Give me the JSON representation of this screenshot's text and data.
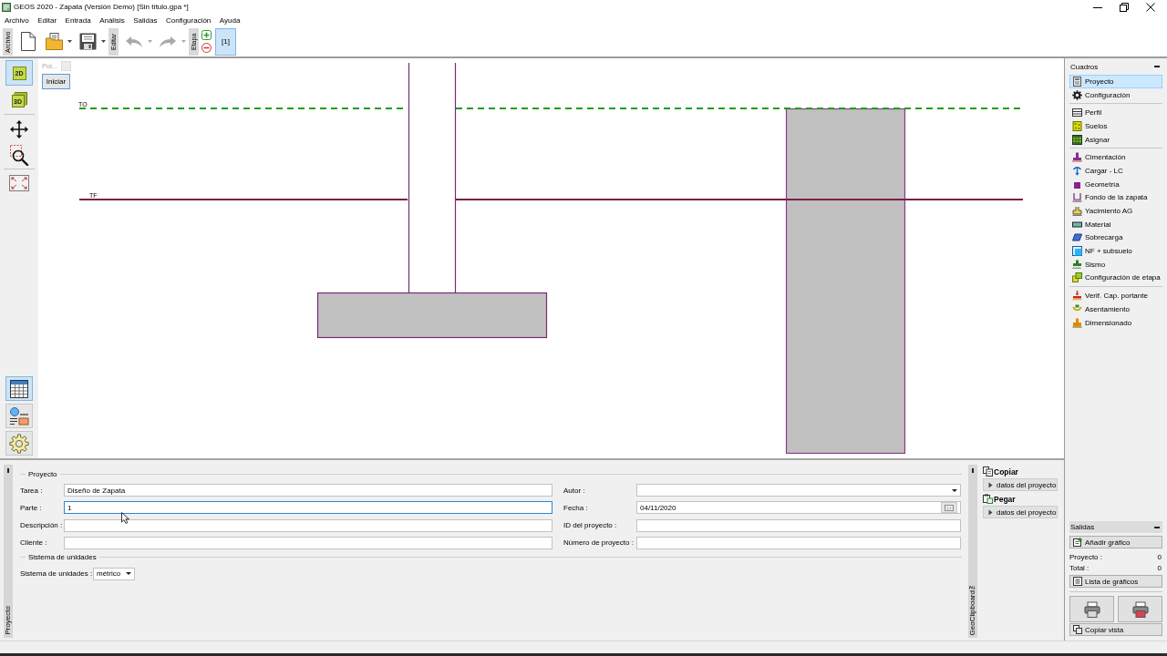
{
  "window": {
    "title": "GEOS 2020 - Zapata (Versión Demo) [Sin título.gpa *]"
  },
  "menu": [
    "Archivo",
    "Editar",
    "Entrada",
    "Análisis",
    "Salidas",
    "Configuración",
    "Ayuda"
  ],
  "toolbar": {
    "sections": [
      {
        "label": "Archivo",
        "tools": [
          {
            "kind": "new",
            "disabled": false
          },
          {
            "kind": "open",
            "disabled": false
          },
          {
            "kind": "save",
            "disabled": false
          }
        ]
      },
      {
        "label": "Editar",
        "tools": [
          {
            "kind": "undo",
            "disabled": true
          },
          {
            "kind": "redo",
            "disabled": true
          }
        ]
      },
      {
        "label": "Etapa",
        "tools": [
          {
            "kind": "add",
            "disabled": false
          },
          {
            "kind": "remove",
            "disabled": false
          }
        ]
      }
    ],
    "stages": [
      {
        "label": "[1]",
        "selected": true
      }
    ]
  },
  "view_tools": [
    {
      "label": "2D",
      "selected": true
    },
    {
      "label": "3D",
      "selected": false
    }
  ],
  "nav_tools": [
    {
      "kind": "move"
    },
    {
      "kind": "zoom"
    },
    {
      "kind": "fit"
    }
  ],
  "panel_tools": [
    {
      "kind": "table",
      "selected": true
    },
    {
      "kind": "legend",
      "selected": false
    },
    {
      "kind": "settings",
      "selected": false
    }
  ],
  "canvas": {
    "hint": {
      "label": "Poi...",
      "disabled": true
    },
    "start_button": "Iniciar",
    "levels": [
      {
        "label": "TO",
        "kind": "dashed",
        "color": "#1e9e1e"
      },
      {
        "label": "TF",
        "kind": "solid",
        "color": "#7b1f45"
      }
    ]
  },
  "cuadros": {
    "title": "Cuadros",
    "groups": [
      {
        "items": [
          {
            "label": "Proyecto",
            "kind": "project",
            "selected": true
          },
          {
            "label": "Configuración",
            "kind": "settings",
            "selected": false
          }
        ]
      },
      {
        "items": [
          {
            "label": "Perfil",
            "kind": "profile",
            "selected": false
          },
          {
            "label": "Suelos",
            "kind": "soils",
            "selected": false
          },
          {
            "label": "Asignar",
            "kind": "assign",
            "selected": false
          }
        ]
      },
      {
        "items": [
          {
            "label": "Cimentación",
            "kind": "foundation",
            "selected": false
          },
          {
            "label": "Cargar - LC",
            "kind": "load",
            "selected": false
          },
          {
            "label": "Geometría",
            "kind": "geometry",
            "selected": false
          },
          {
            "label": "Fondo de la zapata",
            "kind": "base",
            "selected": false
          },
          {
            "label": "Yacimiento AG",
            "kind": "sand",
            "selected": false
          },
          {
            "label": "Material",
            "kind": "material",
            "selected": false
          },
          {
            "label": "Sobrecarga",
            "kind": "surcharge",
            "selected": false
          },
          {
            "label": "NF + subsuelo",
            "kind": "water",
            "selected": false
          },
          {
            "label": "Sismo",
            "kind": "earthquake",
            "selected": false
          },
          {
            "label": "Configuración de etapa",
            "kind": "stage",
            "selected": false
          }
        ]
      },
      {
        "items": [
          {
            "label": "Verif. Cap. portante",
            "kind": "bearing",
            "selected": false
          },
          {
            "label": "Asentamiento",
            "kind": "settlement",
            "selected": false
          },
          {
            "label": "Dimensionado",
            "kind": "sizing",
            "selected": false
          }
        ]
      }
    ]
  },
  "project_tab": "Proyecto",
  "project_form": {
    "group": "Proyecto",
    "fields_left": [
      {
        "label": "Tarea :",
        "kind": "text",
        "value": "Diseño de Zapata",
        "focused": false
      },
      {
        "label": "Parte :",
        "kind": "text",
        "value": "1",
        "focused": true
      },
      {
        "label": "Descripción :",
        "kind": "text",
        "focused": false
      },
      {
        "label": "Cliente :",
        "kind": "text",
        "focused": false
      }
    ],
    "fields_right": [
      {
        "label": "Autor :",
        "kind": "combo",
        "focused": false
      },
      {
        "label": "Fecha :",
        "kind": "date",
        "value": "04/11/2020",
        "focused": false
      },
      {
        "label": "ID del proyecto :",
        "kind": "text",
        "focused": false
      },
      {
        "label": "Número de proyecto :",
        "kind": "text",
        "focused": false
      }
    ],
    "units_group": "Sistema de unidades",
    "units": {
      "label": "Sistema de unidades :",
      "value": "métrico"
    }
  },
  "clipboard": {
    "tab": "GeoClipboard™",
    "actions": [
      {
        "kind": "copy",
        "label": "Copiar",
        "button": "datos del proyecto"
      },
      {
        "kind": "paste",
        "label": "Pegar",
        "button": "datos del proyecto"
      }
    ]
  },
  "salidas": {
    "title": "Salidas",
    "add_button": "Añadir gráfico",
    "counts": [
      {
        "label": "Proyecto :",
        "value": "0"
      },
      {
        "label": "Total :",
        "value": "0"
      }
    ],
    "list_button": "Lista de gráficos",
    "copy_view_button": "Copiar vista"
  }
}
